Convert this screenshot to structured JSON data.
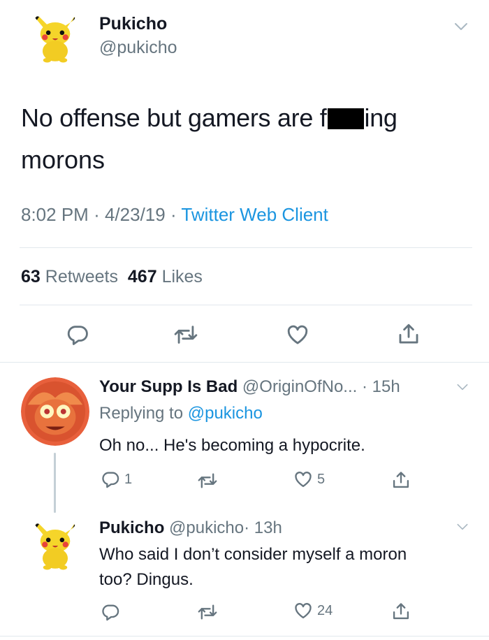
{
  "main_tweet": {
    "name": "Pukicho",
    "handle": "@pukicho",
    "text_part1": "No offense but gamers are f",
    "text_part2": "ing",
    "text_line2": "morons",
    "time": "8:02 PM",
    "sep1": "·",
    "date": "4/23/19",
    "sep2": "·",
    "source": "Twitter Web Client",
    "retweet_count": "63",
    "retweet_label": "Retweets",
    "like_count": "467",
    "like_label": "Likes"
  },
  "reply1": {
    "name": "Your Supp Is Bad",
    "handle": "@OriginOfNo...",
    "time": "· 15h",
    "replying_label": "Replying to",
    "replying_handle": "@pukicho",
    "text": "Oh no... He's becoming a hypocrite.",
    "reply_count": "1",
    "like_count": "5"
  },
  "reply2": {
    "name": "Pukicho",
    "handle": "@pukicho",
    "time": "· 13h",
    "text_line1": "Who said I don’t consider myself a moron",
    "text_line2": "too? Dingus.",
    "like_count": "24"
  },
  "colors": {
    "link": "#1b95e0",
    "muted": "#66757f",
    "divider": "#e1e8ed",
    "thread_line": "#c4cfd6"
  },
  "icons": [
    "chevron-down-icon",
    "reply-icon",
    "retweet-icon",
    "like-icon",
    "share-icon"
  ]
}
